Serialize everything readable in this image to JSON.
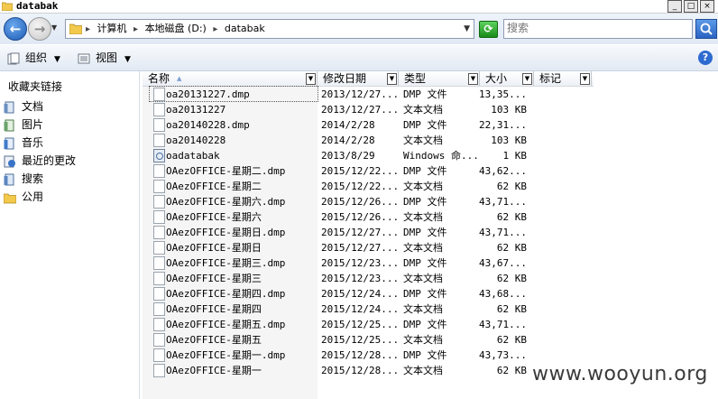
{
  "window": {
    "title": "databak"
  },
  "address": {
    "crumbs": [
      "计算机",
      "本地磁盘 (D:)",
      "databak"
    ]
  },
  "search": {
    "placeholder": "搜索"
  },
  "toolbar": {
    "organize_label": "组织",
    "view_label": "视图"
  },
  "navpane": {
    "heading": "收藏夹链接",
    "items": [
      {
        "label": "文档",
        "icon": "documents-icon"
      },
      {
        "label": "图片",
        "icon": "pictures-icon"
      },
      {
        "label": "音乐",
        "icon": "music-icon"
      },
      {
        "label": "最近的更改",
        "icon": "recent-changes-icon"
      },
      {
        "label": "搜索",
        "icon": "search-folder-icon"
      },
      {
        "label": "公用",
        "icon": "public-folder-icon"
      }
    ]
  },
  "columns": {
    "name": "名称",
    "date": "修改日期",
    "type": "类型",
    "size": "大小",
    "tags": "标记"
  },
  "files": [
    {
      "name": "oa20131227.dmp",
      "date": "2013/12/27...",
      "type": "DMP 文件",
      "size": "13,35...",
      "icon": "file-icon"
    },
    {
      "name": "oa20131227",
      "date": "2013/12/27...",
      "type": "文本文档",
      "size": "103 KB",
      "icon": "file-icon"
    },
    {
      "name": "oa20140228.dmp",
      "date": "2014/2/28",
      "type": "DMP 文件",
      "size": "22,31...",
      "icon": "file-icon"
    },
    {
      "name": "oa20140228",
      "date": "2014/2/28",
      "type": "文本文档",
      "size": "103 KB",
      "icon": "file-icon"
    },
    {
      "name": "oadatabak",
      "date": "2013/8/29",
      "type": "Windows 命...",
      "size": "1 KB",
      "icon": "batch-file-icon"
    },
    {
      "name": "OAezOFFICE-星期二.dmp",
      "date": "2015/12/22...",
      "type": "DMP 文件",
      "size": "43,62...",
      "icon": "file-icon"
    },
    {
      "name": "OAezOFFICE-星期二",
      "date": "2015/12/22...",
      "type": "文本文档",
      "size": "62 KB",
      "icon": "file-icon"
    },
    {
      "name": "OAezOFFICE-星期六.dmp",
      "date": "2015/12/26...",
      "type": "DMP 文件",
      "size": "43,71...",
      "icon": "file-icon"
    },
    {
      "name": "OAezOFFICE-星期六",
      "date": "2015/12/26...",
      "type": "文本文档",
      "size": "62 KB",
      "icon": "file-icon"
    },
    {
      "name": "OAezOFFICE-星期日.dmp",
      "date": "2015/12/27...",
      "type": "DMP 文件",
      "size": "43,71...",
      "icon": "file-icon"
    },
    {
      "name": "OAezOFFICE-星期日",
      "date": "2015/12/27...",
      "type": "文本文档",
      "size": "62 KB",
      "icon": "file-icon"
    },
    {
      "name": "OAezOFFICE-星期三.dmp",
      "date": "2015/12/23...",
      "type": "DMP 文件",
      "size": "43,67...",
      "icon": "file-icon"
    },
    {
      "name": "OAezOFFICE-星期三",
      "date": "2015/12/23...",
      "type": "文本文档",
      "size": "62 KB",
      "icon": "file-icon"
    },
    {
      "name": "OAezOFFICE-星期四.dmp",
      "date": "2015/12/24...",
      "type": "DMP 文件",
      "size": "43,68...",
      "icon": "file-icon"
    },
    {
      "name": "OAezOFFICE-星期四",
      "date": "2015/12/24...",
      "type": "文本文档",
      "size": "62 KB",
      "icon": "file-icon"
    },
    {
      "name": "OAezOFFICE-星期五.dmp",
      "date": "2015/12/25...",
      "type": "DMP 文件",
      "size": "43,71...",
      "icon": "file-icon"
    },
    {
      "name": "OAezOFFICE-星期五",
      "date": "2015/12/25...",
      "type": "文本文档",
      "size": "62 KB",
      "icon": "file-icon"
    },
    {
      "name": "OAezOFFICE-星期一.dmp",
      "date": "2015/12/28...",
      "type": "DMP 文件",
      "size": "43,73...",
      "icon": "file-icon"
    },
    {
      "name": "OAezOFFICE-星期一",
      "date": "2015/12/28...",
      "type": "文本文档",
      "size": "62 KB",
      "icon": "file-icon"
    }
  ],
  "watermark": "www.wooyun.org"
}
